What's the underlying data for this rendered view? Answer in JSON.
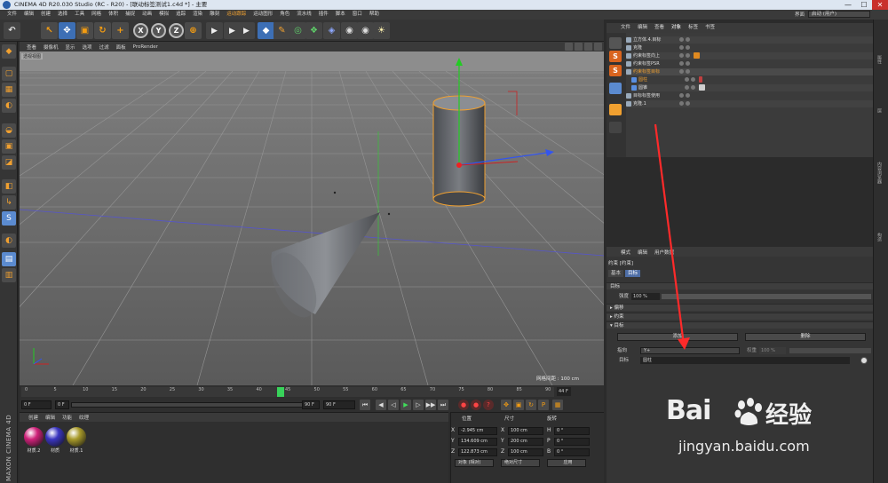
{
  "window": {
    "title": "CINEMA 4D R20.030 Studio (RC - R20) - [联动标签测试1.c4d *] - 主要",
    "min": "—",
    "max": "☐",
    "close": "✕"
  },
  "menubar": {
    "items": [
      "文件",
      "编辑",
      "创建",
      "选择",
      "工具",
      "网格",
      "体积",
      "捕捉",
      "动画",
      "模拟",
      "追踪",
      "渲染",
      "雕刻",
      "运动跟踪",
      "运动图形",
      "角色",
      "流水线",
      "插件",
      "脚本",
      "窗口",
      "帮助"
    ],
    "layout_label": "界面",
    "layout_value": "启动 (用户)"
  },
  "toolbar": {
    "undo": "↶",
    "select": "↖",
    "move": "✥",
    "scale": "▣",
    "rotate": "↻",
    "add": "+",
    "x": "X",
    "y": "Y",
    "z": "Z",
    "coord": "⊕",
    "film1": "▶",
    "film2": "▶",
    "film3": "▶",
    "cube": "◆",
    "pen": "✎",
    "subdiv": "◎",
    "array": "❖",
    "deform": "◈",
    "camera": "◉",
    "light": "☀"
  },
  "lefttools": {
    "icons": [
      "◆",
      "▢",
      "▦",
      "◐",
      "◒",
      "▣",
      "◪",
      "◧",
      "↳",
      "↳",
      "S",
      "◐",
      "▤",
      "▥"
    ]
  },
  "viewport": {
    "menu": [
      "查看",
      "摄像机",
      "显示",
      "选项",
      "过滤",
      "面板",
      "ProRender"
    ],
    "label": "透视视图",
    "grid_label": "网格间距 : 100 cm"
  },
  "timeline": {
    "ticks": [
      "0",
      "5",
      "10",
      "15",
      "20",
      "25",
      "30",
      "35",
      "40",
      "45",
      "50",
      "55",
      "60",
      "65",
      "70",
      "75",
      "80",
      "85",
      "90"
    ],
    "current_frame": 44,
    "max_frame": 90,
    "frame_label": "44 F",
    "start_field": "0 F",
    "start_field2": "0 F",
    "end_field": "90 F",
    "end_field2": "90 F",
    "buttons": [
      "⏮",
      "◀",
      "◁",
      "▶",
      "▷",
      "▶▶",
      "⏭",
      "●",
      "●",
      "?",
      "✥",
      "▣",
      "↻",
      "P",
      "▦"
    ]
  },
  "materials": {
    "menu": [
      "创建",
      "编辑",
      "功能",
      "纹理"
    ],
    "items": [
      {
        "label": "材质.2",
        "color": "#d0227a"
      },
      {
        "label": "材质",
        "color": "#3a35c0"
      },
      {
        "label": "材质.1",
        "color": "#a89a2a"
      }
    ],
    "brand": "MAXON CINEMA 4D"
  },
  "coords": {
    "head_pos": "位置",
    "head_size": "尺寸",
    "head_rot": "旋转",
    "rows": [
      {
        "axis": "X",
        "pos": "-2.945 cm",
        "size": "100 cm",
        "raxis": "H",
        "rot": "0 °"
      },
      {
        "axis": "Y",
        "pos": "134.609 cm",
        "size": "200 cm",
        "raxis": "P",
        "rot": "0 °"
      },
      {
        "axis": "Z",
        "pos": "122.873 cm",
        "size": "100 cm",
        "raxis": "B",
        "rot": "0 °"
      }
    ],
    "mode": "对象 (相对)",
    "size_mode": "绝对尺寸",
    "apply": "应用"
  },
  "objects": {
    "tabs": [
      "文件",
      "编辑",
      "查看",
      "对象",
      "标签",
      "书签"
    ],
    "rows": [
      {
        "name": "立方体.4.目标",
        "highlight": false
      },
      {
        "name": "克隆",
        "highlight": false
      },
      {
        "name": "约束标签向上",
        "highlight": false
      },
      {
        "name": "约束标签PSR",
        "highlight": false
      },
      {
        "name": "约束标签目标",
        "highlight": true
      },
      {
        "name": "圆柱",
        "highlight": false
      },
      {
        "name": "圆锥",
        "highlight": false
      },
      {
        "name": "目标标签使用",
        "highlight": false
      },
      {
        "name": "克隆.1",
        "highlight": false
      }
    ]
  },
  "attributes": {
    "menu": [
      "模式",
      "编辑",
      "用户数据"
    ],
    "header": "约束 [约束]",
    "tabs": [
      "基本",
      "目标"
    ],
    "section_target": "目标",
    "strength_label": "强度",
    "strength_value": "100 %",
    "sections": [
      "▸ 偏移",
      "▸ 约束",
      "▾ 目标"
    ],
    "add_btn": "添加",
    "remove_btn": "删除",
    "aim_label": "指向",
    "aim_value": "Y+",
    "weight_label": "权重",
    "weight_value": "100 %",
    "target_label": "目标",
    "target_value": "圆柱"
  },
  "right_strip": [
    "属性",
    "层",
    "内容浏览器",
    "构造"
  ],
  "watermark": {
    "brand": "Bai",
    "brand_cn": "经验",
    "url": "jingyan.baidu.com"
  },
  "colors": {
    "accent": "#f0a030",
    "selection": "#4e6ea6",
    "annotation": "#ff2a2a"
  }
}
